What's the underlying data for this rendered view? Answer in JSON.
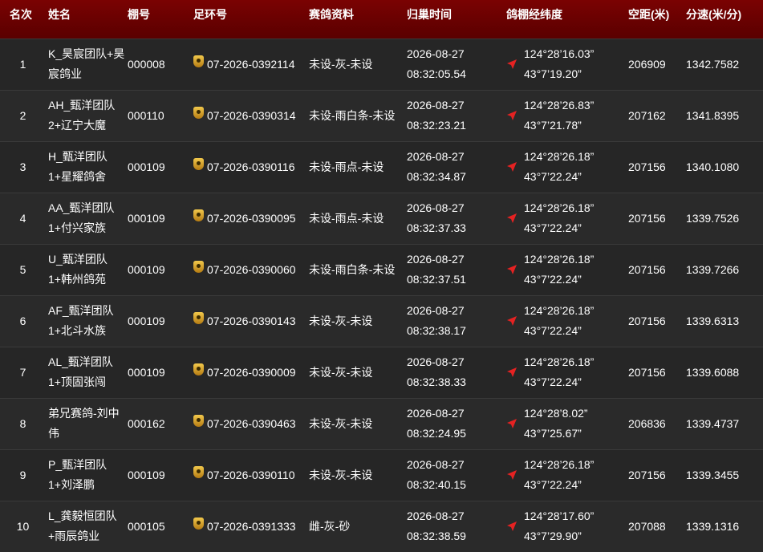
{
  "headers": {
    "rank": "名次",
    "name": "姓名",
    "loft": "棚号",
    "ring": "足环号",
    "info": "赛鸽资料",
    "time": "归巢时间",
    "coords": "鸽棚经纬度",
    "distance": "空距(米)",
    "speed": "分速(米/分)"
  },
  "colors": {
    "header_bg": "#6b0000",
    "arrow": "#e52222",
    "shield": "#d9a520"
  },
  "rows": [
    {
      "rank": "1",
      "name1": "K_昊宸团队+昊",
      "name2": "宸鸽业",
      "loft": "000008",
      "ring": "07-2026-0392114",
      "info": "未设-灰-未设",
      "date": "2026-08-27",
      "time": "08:32:05.54",
      "lon": "124°28’16.03”",
      "lat": "43°7’19.20”",
      "distance": "206909",
      "speed": "1342.7582"
    },
    {
      "rank": "2",
      "name1": "AH_甄洋团队",
      "name2": "2+辽宁大魔",
      "loft": "000110",
      "ring": "07-2026-0390314",
      "info": "未设-雨白条-未设",
      "date": "2026-08-27",
      "time": "08:32:23.21",
      "lon": "124°28’26.83”",
      "lat": "43°7’21.78”",
      "distance": "207162",
      "speed": "1341.8395"
    },
    {
      "rank": "3",
      "name1": "H_甄洋团队",
      "name2": "1+星耀鸽舍",
      "loft": "000109",
      "ring": "07-2026-0390116",
      "info": "未设-雨点-未设",
      "date": "2026-08-27",
      "time": "08:32:34.87",
      "lon": "124°28’26.18”",
      "lat": "43°7’22.24”",
      "distance": "207156",
      "speed": "1340.1080"
    },
    {
      "rank": "4",
      "name1": "AA_甄洋团队",
      "name2": "1+付兴家族",
      "loft": "000109",
      "ring": "07-2026-0390095",
      "info": "未设-雨点-未设",
      "date": "2026-08-27",
      "time": "08:32:37.33",
      "lon": "124°28’26.18”",
      "lat": "43°7’22.24”",
      "distance": "207156",
      "speed": "1339.7526"
    },
    {
      "rank": "5",
      "name1": "U_甄洋团队",
      "name2": "1+韩州鸽苑",
      "loft": "000109",
      "ring": "07-2026-0390060",
      "info": "未设-雨白条-未设",
      "date": "2026-08-27",
      "time": "08:32:37.51",
      "lon": "124°28’26.18”",
      "lat": "43°7’22.24”",
      "distance": "207156",
      "speed": "1339.7266"
    },
    {
      "rank": "6",
      "name1": "AF_甄洋团队",
      "name2": "1+北斗水族",
      "loft": "000109",
      "ring": "07-2026-0390143",
      "info": "未设-灰-未设",
      "date": "2026-08-27",
      "time": "08:32:38.17",
      "lon": "124°28’26.18”",
      "lat": "43°7’22.24”",
      "distance": "207156",
      "speed": "1339.6313"
    },
    {
      "rank": "7",
      "name1": "AL_甄洋团队",
      "name2": "1+顶固张闯",
      "loft": "000109",
      "ring": "07-2026-0390009",
      "info": "未设-灰-未设",
      "date": "2026-08-27",
      "time": "08:32:38.33",
      "lon": "124°28’26.18”",
      "lat": "43°7’22.24”",
      "distance": "207156",
      "speed": "1339.6088"
    },
    {
      "rank": "8",
      "name1": "弟兄赛鸽-刘中",
      "name2": "伟",
      "loft": "000162",
      "ring": "07-2026-0390463",
      "info": "未设-灰-未设",
      "date": "2026-08-27",
      "time": "08:32:24.95",
      "lon": "124°28’8.02”",
      "lat": "43°7’25.67”",
      "distance": "206836",
      "speed": "1339.4737"
    },
    {
      "rank": "9",
      "name1": "P_甄洋团队",
      "name2": "1+刘泽鹏",
      "loft": "000109",
      "ring": "07-2026-0390110",
      "info": "未设-灰-未设",
      "date": "2026-08-27",
      "time": "08:32:40.15",
      "lon": "124°28’26.18”",
      "lat": "43°7’22.24”",
      "distance": "207156",
      "speed": "1339.3455"
    },
    {
      "rank": "10",
      "name1": "L_龚毅恒团队",
      "name2": "+雨辰鸽业",
      "loft": "000105",
      "ring": "07-2026-0391333",
      "info": "雌-灰-砂",
      "date": "2026-08-27",
      "time": "08:32:38.59",
      "lon": "124°28’17.60”",
      "lat": "43°7’29.90”",
      "distance": "207088",
      "speed": "1339.1316"
    }
  ]
}
